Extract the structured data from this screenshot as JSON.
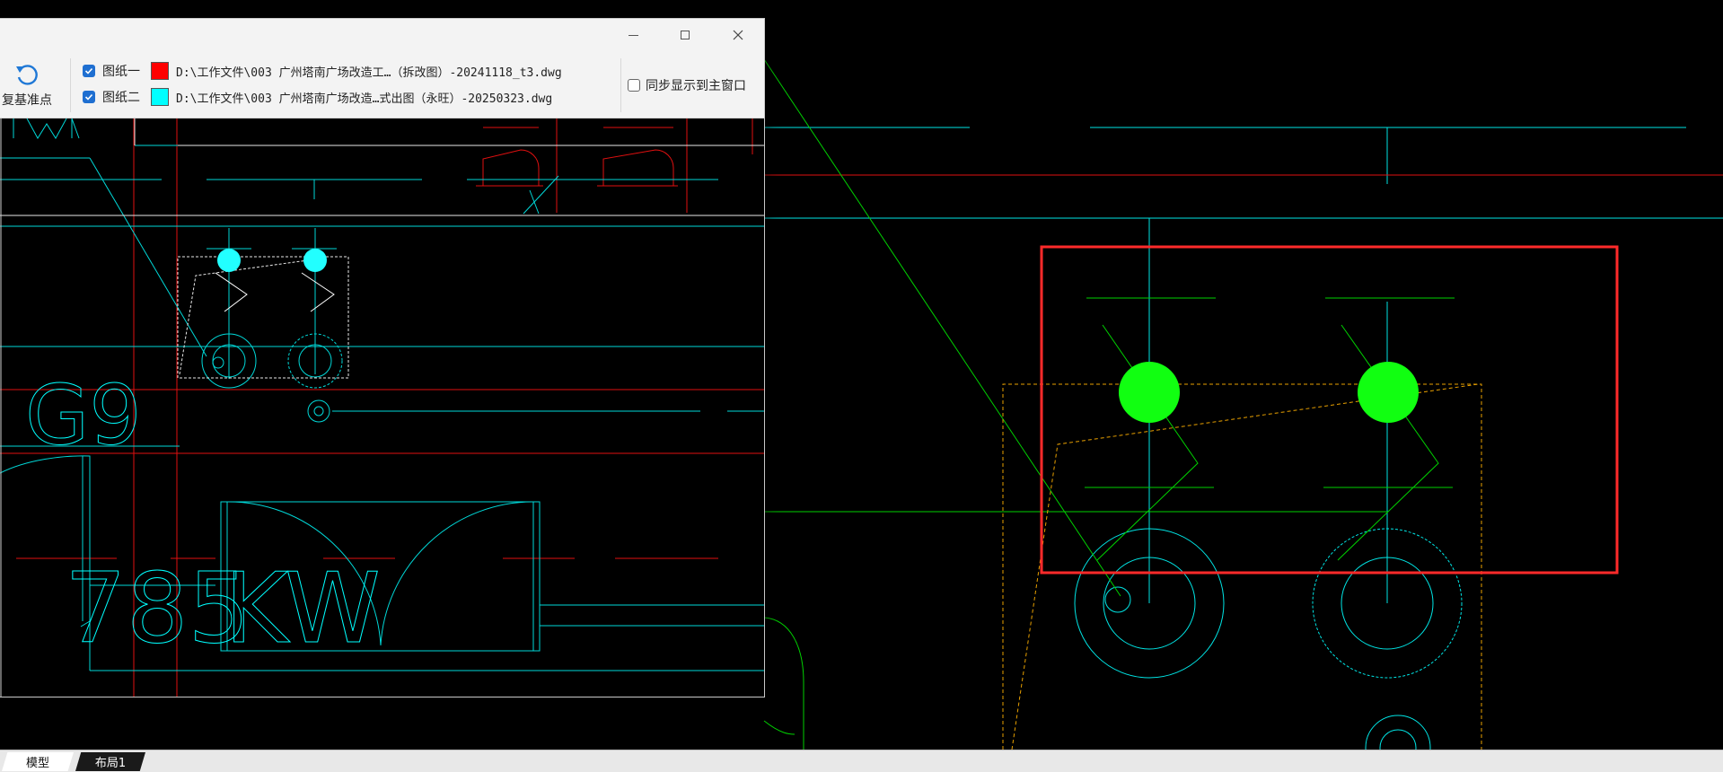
{
  "window": {
    "minimize_icon": "minimize-icon",
    "maximize_icon": "maximize-icon",
    "close_icon": "close-icon"
  },
  "toolbar": {
    "reset_base_label": "复基准点",
    "reset_icon": "rotate-ccw-icon",
    "drawings": [
      {
        "checked": true,
        "label": "图纸一",
        "color": "#ff0000",
        "path": "D:\\工作文件\\003 广州塔南广场改造工…（拆改图）-20241118_t3.dwg"
      },
      {
        "checked": true,
        "label": "图纸二",
        "color": "#00ffff",
        "path": "D:\\工作文件\\003 广州塔南广场改造…式出图（永旺）-20250323.dwg"
      }
    ],
    "sync_checked": false,
    "sync_label": "同步显示到主窗口"
  },
  "compare_view": {
    "texts": [
      {
        "text": "G9",
        "color": "#00ffff"
      },
      {
        "text": "785",
        "color": "#00ffff"
      },
      {
        "text": "KW",
        "color": "#00ffff"
      }
    ]
  },
  "colors": {
    "cyan": "#00ffff",
    "red": "#ff2020",
    "green": "#00ff00",
    "orange": "#ffa500",
    "white": "#ffffff",
    "highlight_box": "#ff2a2a"
  },
  "tabs": [
    {
      "label": "模型",
      "active": true
    },
    {
      "label": "布局1",
      "active": false
    }
  ]
}
